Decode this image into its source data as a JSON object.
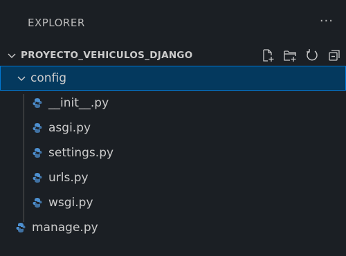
{
  "explorer": {
    "title": "EXPLORER",
    "more_label": "···",
    "project": {
      "name": "PROYECTO_VEHICULOS_DJANGO",
      "actions": [
        "new-file-icon",
        "new-folder-icon",
        "refresh-icon",
        "collapse-all-icon"
      ]
    },
    "folder": {
      "name": "config",
      "expanded": true,
      "selected": true
    },
    "folder_files": [
      {
        "name": "__init__.py",
        "icon": "python-file-icon"
      },
      {
        "name": "asgi.py",
        "icon": "python-file-icon"
      },
      {
        "name": "settings.py",
        "icon": "python-file-icon"
      },
      {
        "name": "urls.py",
        "icon": "python-file-icon"
      },
      {
        "name": "wsgi.py",
        "icon": "python-file-icon"
      }
    ],
    "root_files": [
      {
        "name": "manage.py",
        "icon": "python-file-icon"
      }
    ],
    "colors": {
      "background": "#1b1f24",
      "selection": "#04395e",
      "selection_border": "#0078d4",
      "python_icon": "#4d8fcf"
    }
  }
}
